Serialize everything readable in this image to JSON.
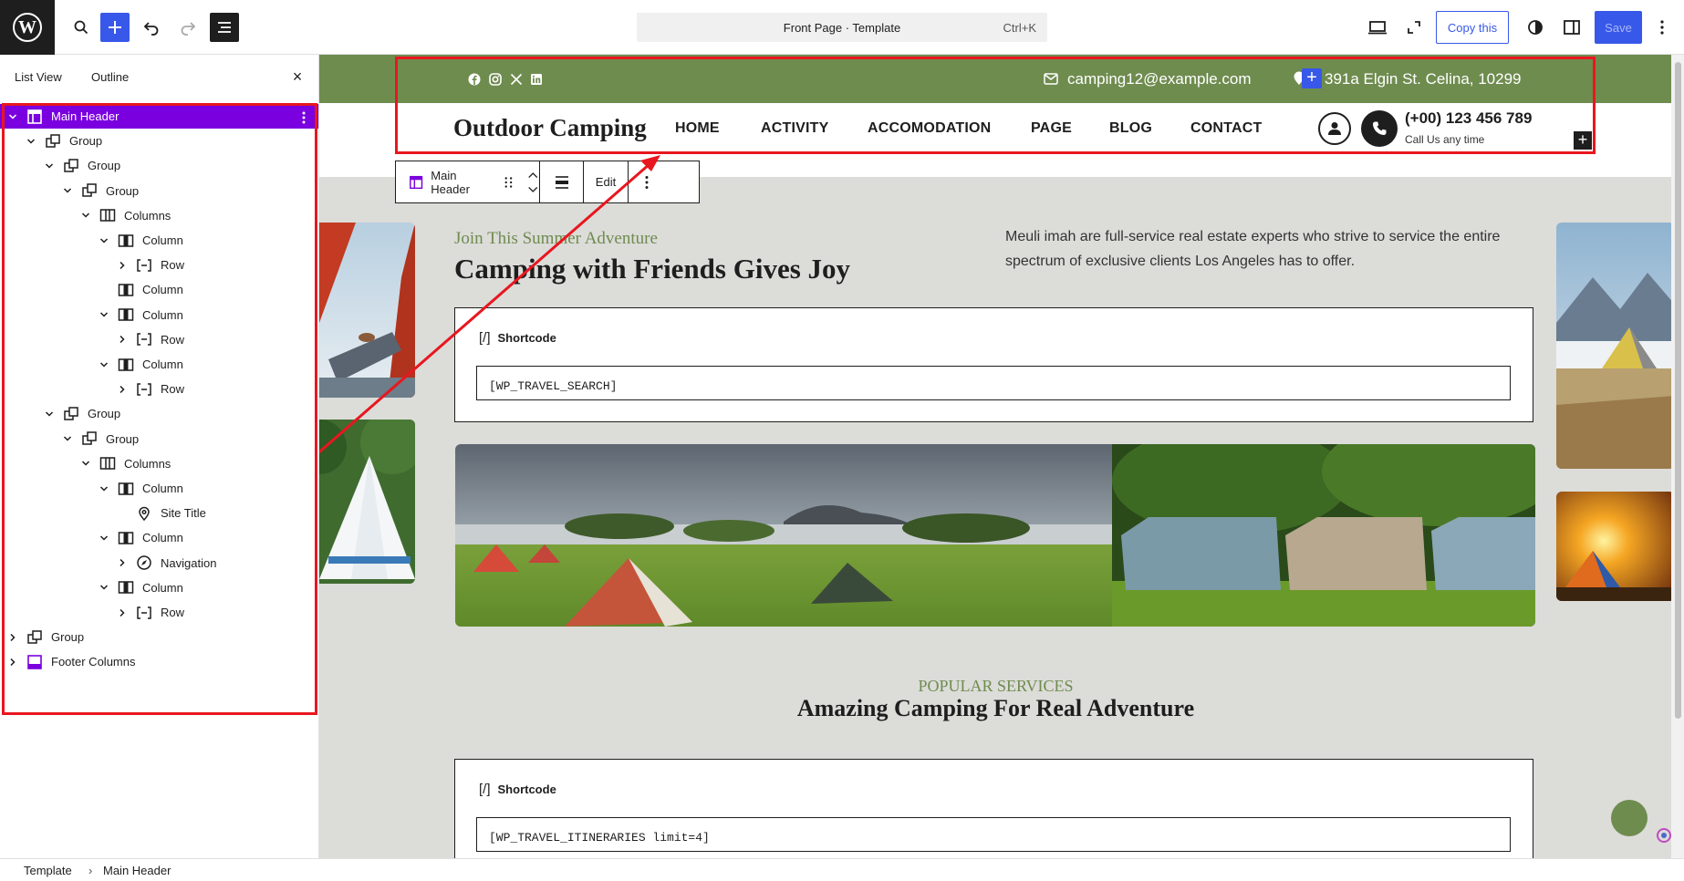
{
  "topbar": {
    "document_title": "Front Page · Template",
    "shortcut": "Ctrl+K",
    "copy_label": "Copy this",
    "save_label": "Save"
  },
  "list_view": {
    "tab_list": "List View",
    "tab_outline": "Outline",
    "close_symbol": "×",
    "items": [
      {
        "label": "Main Header"
      },
      {
        "label": "Group"
      },
      {
        "label": "Group"
      },
      {
        "label": "Group"
      },
      {
        "label": "Columns"
      },
      {
        "label": "Column"
      },
      {
        "label": "Row"
      },
      {
        "label": "Column"
      },
      {
        "label": "Column"
      },
      {
        "label": "Row"
      },
      {
        "label": "Column"
      },
      {
        "label": "Row"
      },
      {
        "label": "Group"
      },
      {
        "label": "Group"
      },
      {
        "label": "Columns"
      },
      {
        "label": "Column"
      },
      {
        "label": "Site Title"
      },
      {
        "label": "Column"
      },
      {
        "label": "Navigation"
      },
      {
        "label": "Column"
      },
      {
        "label": "Row"
      },
      {
        "label": "Group"
      },
      {
        "label": "Footer Columns"
      }
    ]
  },
  "header": {
    "email": "camping12@example.com",
    "address": "391a Elgin St. Celina, 10299",
    "site_title": "Outdoor Camping",
    "nav": [
      "HOME",
      "ACTIVITY",
      "ACCOMODATION",
      "PAGE",
      "BLOG",
      "CONTACT"
    ],
    "phone": "(+00) 123 456 789",
    "call_text": "Call Us any time"
  },
  "block_toolbar": {
    "block_name": "Main Header",
    "edit_label": "Edit"
  },
  "content": {
    "kicker": "Join This Summer Adventure",
    "heading": "Camping with Friends Gives Joy",
    "description": "Meuli imah are full-service real estate experts who strive to service the entire spectrum of exclusive clients Los Angeles has to offer.",
    "shortcode_label": "Shortcode",
    "shortcode_icon": "[/]",
    "shortcode1": "[WP_TRAVEL_SEARCH]",
    "services_kicker": "POPULAR SERVICES",
    "services_title": "Amazing Camping For Real Adventure",
    "shortcode2": "[WP_TRAVEL_ITINERARIES limit=4]"
  },
  "breadcrumb": {
    "root": "Template",
    "sep": "›",
    "current": "Main Header"
  },
  "colors": {
    "accent": "#3858e9",
    "selection": "#7a00df",
    "highlight": "#e8171f",
    "brand_green": "#6f8c4f"
  }
}
